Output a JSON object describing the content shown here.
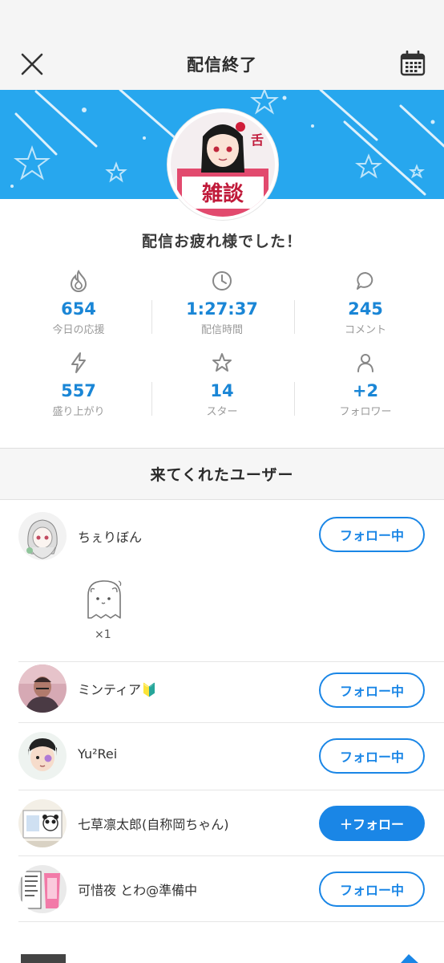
{
  "header": {
    "title": "配信終了",
    "close_icon": "close-icon",
    "calendar_icon": "calendar-icon"
  },
  "banner": {
    "color": "#27a7ee"
  },
  "main": {
    "thanks": "配信お疲れ様でした！",
    "stats": [
      {
        "icon": "flame-icon",
        "value": "654",
        "label": "今日の応援"
      },
      {
        "icon": "clock-icon",
        "value": "1:27:37",
        "label": "配信時間"
      },
      {
        "icon": "comment-icon",
        "value": "245",
        "label": "コメント"
      },
      {
        "icon": "lightning-icon",
        "value": "557",
        "label": "盛り上がり"
      },
      {
        "icon": "star-icon",
        "value": "14",
        "label": "スター"
      },
      {
        "icon": "person-icon",
        "value": "+2",
        "label": "フォロワー"
      }
    ]
  },
  "visitors": {
    "heading": "来てくれたユーザー",
    "users": [
      {
        "name": "ちぇりぼん",
        "button": "フォロー中",
        "following": true
      },
      {
        "name": "ミンティア🔰",
        "button": "フォロー中",
        "following": true
      },
      {
        "name": "Yu²Rei",
        "button": "フォロー中",
        "following": true
      },
      {
        "name": "七草凛太郎(自称岡ちゃん)",
        "button": "＋フォロー",
        "following": false
      },
      {
        "name": "可惜夜 とわ@準備中",
        "button": "フォロー中",
        "following": true
      }
    ],
    "gift": {
      "icon": "ghost-gift-icon",
      "count": "×1"
    }
  },
  "colors": {
    "accent": "#1a86e6",
    "value_blue": "#1a86d6"
  }
}
